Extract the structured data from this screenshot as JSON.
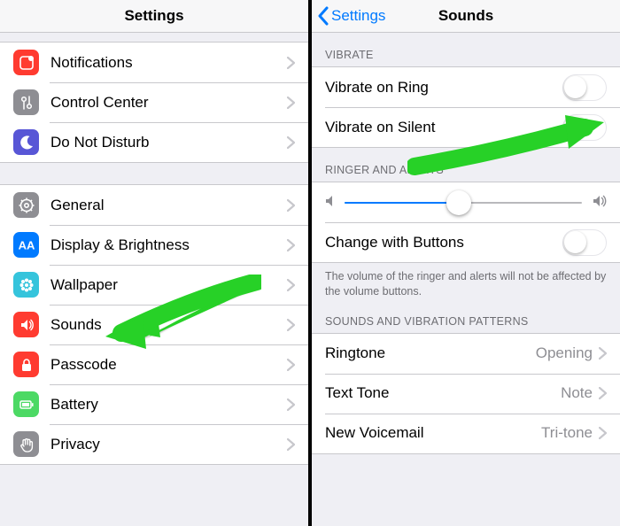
{
  "left": {
    "title": "Settings",
    "group1": [
      {
        "key": "notifications",
        "label": "Notifications",
        "tile": "t-red",
        "icon": "notifications"
      },
      {
        "key": "control-center",
        "label": "Control Center",
        "tile": "t-gray",
        "icon": "control-center"
      },
      {
        "key": "do-not-disturb",
        "label": "Do Not Disturb",
        "tile": "t-purple",
        "icon": "moon"
      }
    ],
    "group2": [
      {
        "key": "general",
        "label": "General",
        "tile": "t-gray",
        "icon": "gear"
      },
      {
        "key": "display",
        "label": "Display & Brightness",
        "tile": "t-blue",
        "icon": "aa"
      },
      {
        "key": "wallpaper",
        "label": "Wallpaper",
        "tile": "t-cyan",
        "icon": "flower"
      },
      {
        "key": "sounds",
        "label": "Sounds",
        "tile": "t-red",
        "icon": "speaker"
      },
      {
        "key": "passcode",
        "label": "Passcode",
        "tile": "t-red",
        "icon": "lock"
      },
      {
        "key": "battery",
        "label": "Battery",
        "tile": "t-green",
        "icon": "battery"
      },
      {
        "key": "privacy",
        "label": "Privacy",
        "tile": "t-gray",
        "icon": "hand"
      }
    ]
  },
  "right": {
    "back_label": "Settings",
    "title": "Sounds",
    "vibrate_header": "Vibrate",
    "vibrate_ring": "Vibrate on Ring",
    "vibrate_silent": "Vibrate on Silent",
    "ringer_header": "Ringer and Alerts",
    "slider_value": 0.48,
    "change_buttons": "Change with Buttons",
    "ringer_footer": "The volume of the ringer and alerts will not be affected by the volume buttons.",
    "patterns_header": "Sounds and Vibration Patterns",
    "patterns": [
      {
        "key": "ringtone",
        "label": "Ringtone",
        "value": "Opening"
      },
      {
        "key": "text-tone",
        "label": "Text Tone",
        "value": "Note"
      },
      {
        "key": "new-voicemail",
        "label": "New Voicemail",
        "value": "Tri-tone"
      }
    ]
  }
}
